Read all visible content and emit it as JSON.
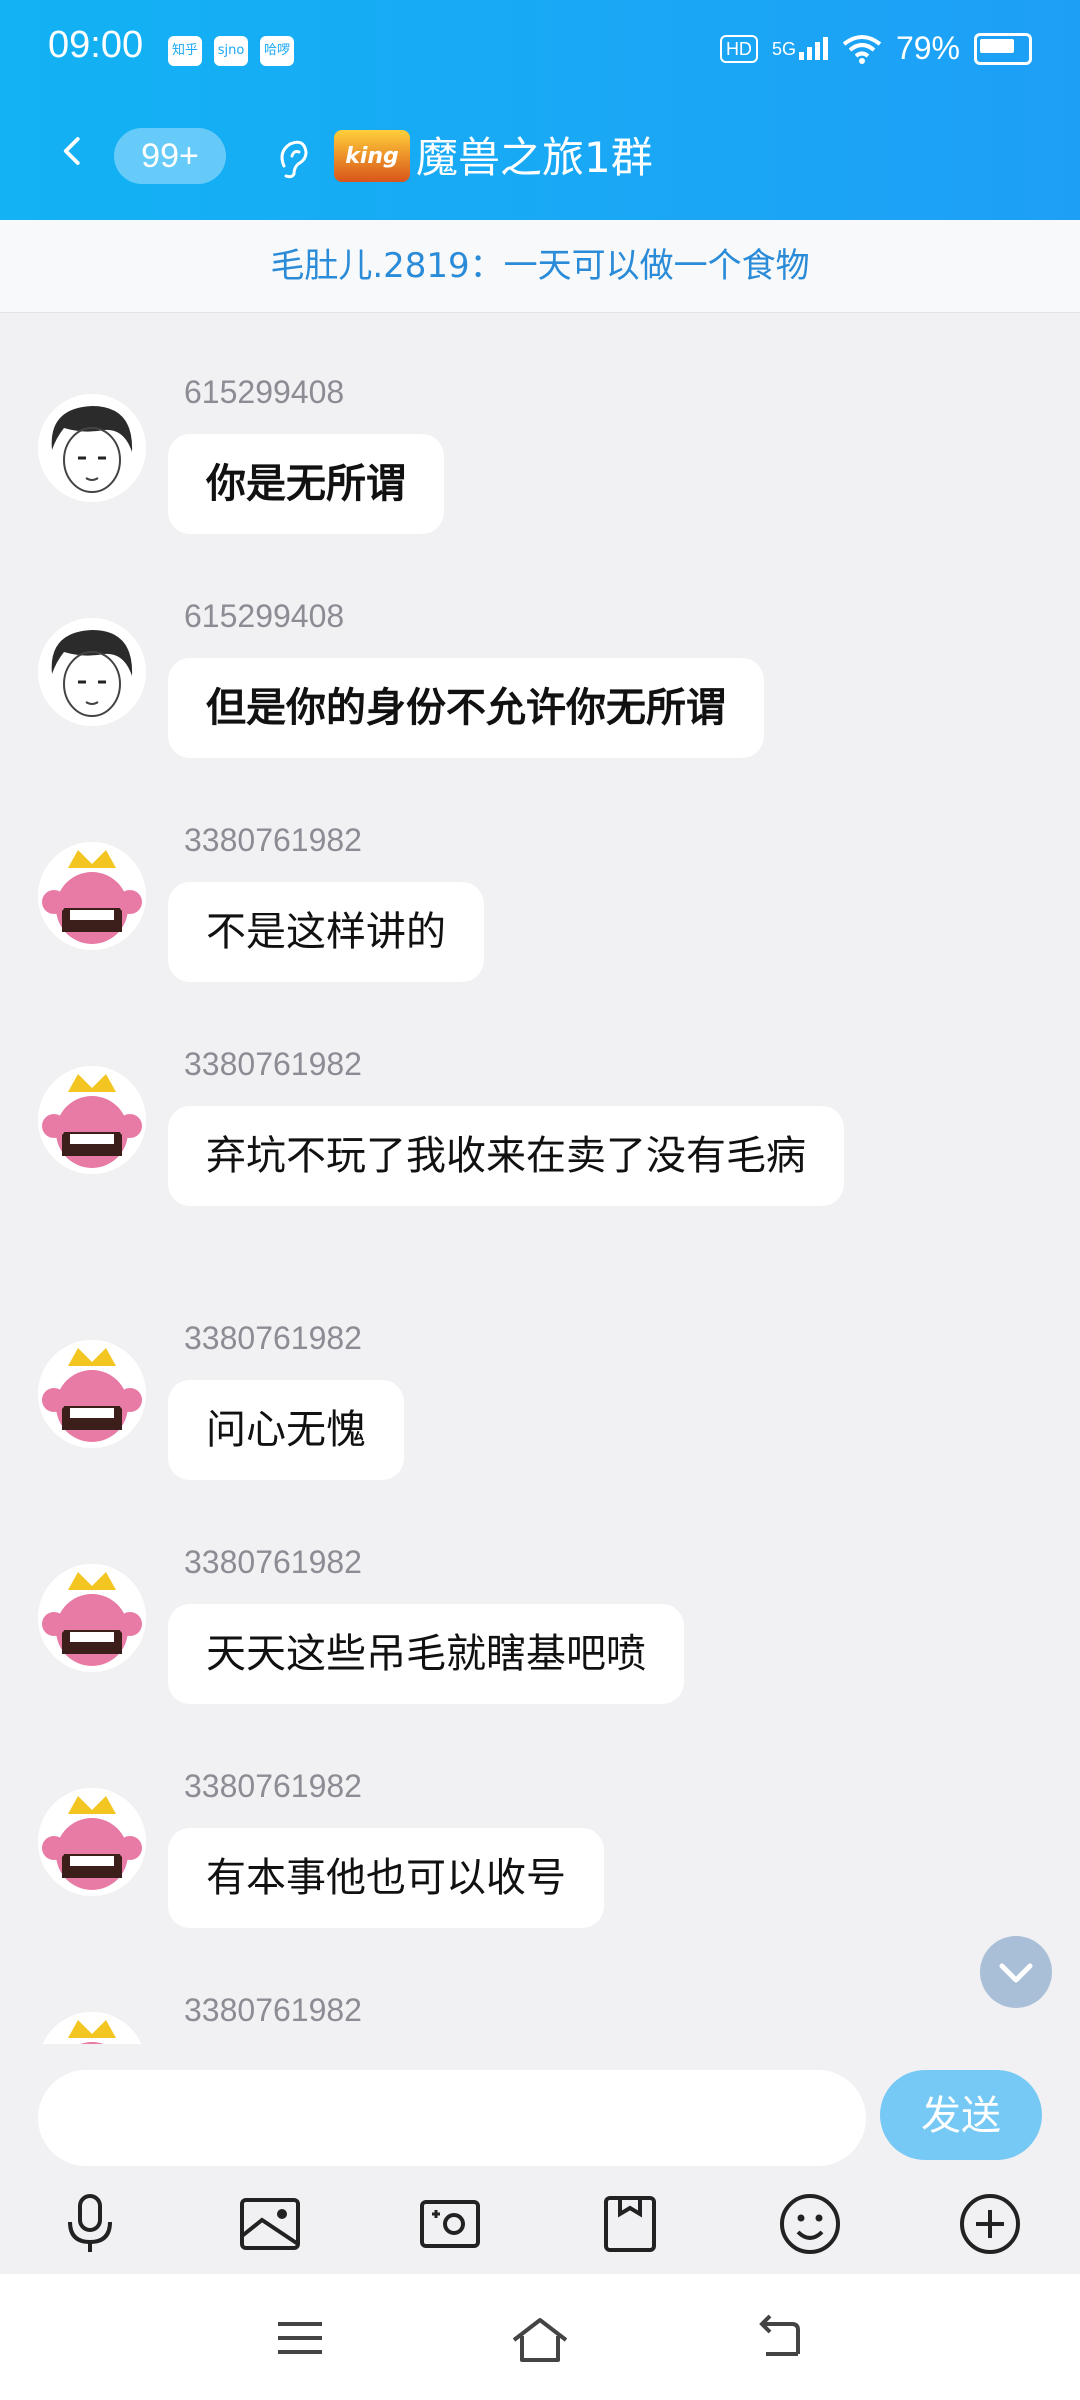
{
  "status_bar": {
    "time": "09:00",
    "notif_apps": [
      "知乎",
      "sjno",
      "哈啰"
    ],
    "hd": "HD",
    "network": "5G",
    "battery": "79%"
  },
  "nav": {
    "unread_count": "99+",
    "group_name": "魔兽之旅1群",
    "group_logo_text": "king"
  },
  "pinned": {
    "text": "毛肚儿.2819：一天可以做一个食物"
  },
  "messages": [
    {
      "sender": "615299408",
      "text": "你是无所谓"
    },
    {
      "sender": "615299408",
      "text": "但是你的身份不允许你无所谓"
    },
    {
      "sender": "3380761982",
      "text": "不是这样讲的"
    },
    {
      "sender": "3380761982",
      "text": "弃坑不玩了我收来在卖了没有毛病"
    },
    {
      "sender": "3380761982",
      "text": "问心无愧"
    },
    {
      "sender": "3380761982",
      "text": "天天这些吊毛就瞎基吧喷"
    },
    {
      "sender": "3380761982",
      "text": "有本事他也可以收号"
    },
    {
      "sender": "3380761982",
      "text": ""
    }
  ],
  "input": {
    "value": "",
    "send_label": "发送"
  },
  "toolbar": [
    "microphone-icon",
    "image-icon",
    "camera-icon",
    "file-icon",
    "emoji-icon",
    "plus-icon"
  ],
  "colors": {
    "header": "#1aa7f5",
    "send_button": "#76c8f5",
    "pinned_text": "#2a8bd8"
  }
}
